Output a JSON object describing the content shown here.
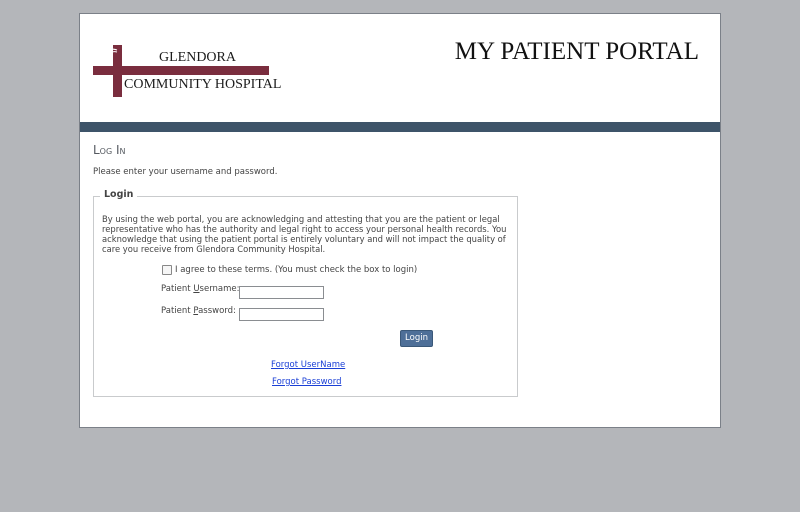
{
  "header": {
    "logo": {
      "line1": "GLENDORA",
      "line2": "COMMUNITY HOSPITAL",
      "icon": "caduceus-icon",
      "color": "#7a2d3e"
    },
    "portal_title": "MY PATIENT PORTAL",
    "band_color": "#3e5469"
  },
  "page": {
    "heading": "Log In",
    "instructions": "Please enter your username and password."
  },
  "login": {
    "legend": "Login",
    "disclaimer": "By using the web portal, you are acknowledging and attesting that you are the patient or legal representative who has the authority and legal right to access your personal health records. You acknowledge that using the patient portal is entirely voluntary and will not impact the quality of care you receive from Glendora Community Hospital.",
    "agree_label": "I agree to these terms. (You must check the box to login)",
    "agree_checked": false,
    "username_label_pre": "Patient ",
    "username_label_key": "U",
    "username_label_post": "sername:",
    "username_value": "",
    "password_label_pre": "Patient ",
    "password_label_key": "P",
    "password_label_post": "assword:",
    "password_value": "",
    "login_button": "Login",
    "forgot_username": "Forgot UserName",
    "forgot_password": "Forgot Password"
  },
  "colors": {
    "background": "#b4b6ba",
    "button": "#4e6f98",
    "link": "#1a3fd6"
  }
}
